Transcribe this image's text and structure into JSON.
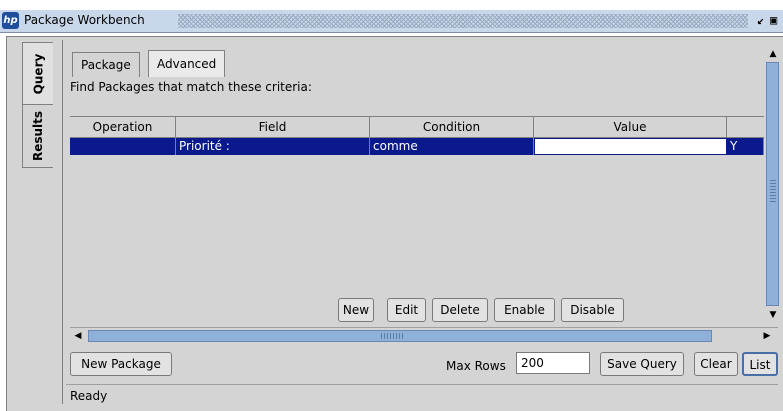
{
  "window": {
    "title": "Package Workbench",
    "logo": "hp",
    "controls": [
      "restore-icon",
      "maximize-icon"
    ],
    "restore_glyph": "↙",
    "maximize_glyph": "▣"
  },
  "side_tabs": [
    "Query",
    "Results"
  ],
  "tabs": {
    "package": "Package",
    "advanced": "Advanced"
  },
  "criteria_text": "Find Packages that match these criteria:",
  "table": {
    "headers": [
      "Operation",
      "Field",
      "Condition",
      "Value",
      ""
    ],
    "rows": [
      {
        "operation": "",
        "field": "Priorité :",
        "condition": "comme",
        "value": "",
        "extra": "Y"
      }
    ]
  },
  "table_buttons": [
    "New",
    "Edit",
    "Delete",
    "Enable",
    "Disable"
  ],
  "bottom": {
    "new_package": "New Package",
    "max_rows_label": "Max Rows",
    "max_rows_value": "200",
    "save_query": "Save Query",
    "clear": "Clear",
    "list": "List"
  },
  "status": "Ready",
  "colors": {
    "selection": "#0a1a8c",
    "titlebar": "#c9d7eb",
    "scroll_thumb": "#8fb0d8"
  }
}
